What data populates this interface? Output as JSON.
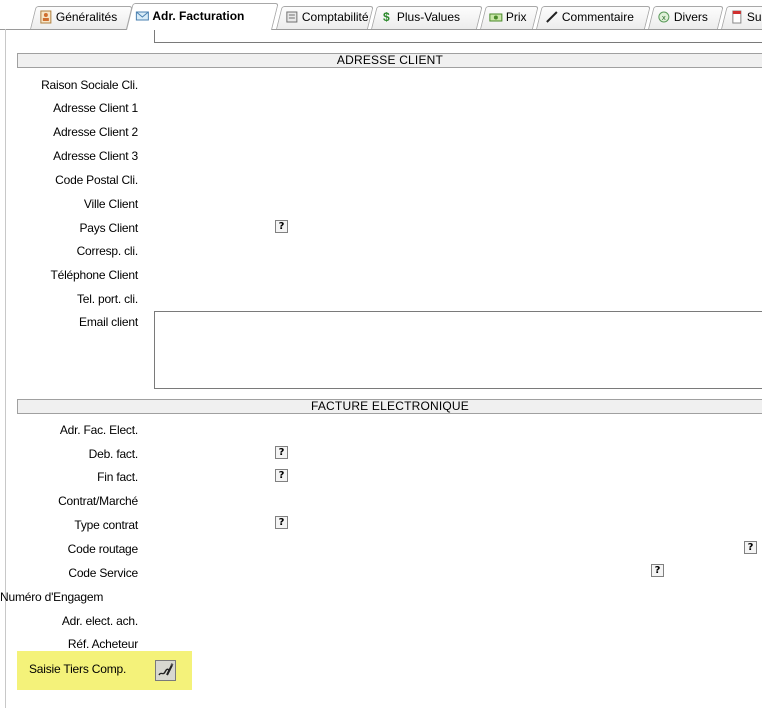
{
  "tabs": [
    {
      "label": "Généralités",
      "icon": "person-card-icon",
      "active": false
    },
    {
      "label": "Adr. Facturation",
      "icon": "envelope-icon",
      "active": true
    },
    {
      "label": "Comptabilité",
      "icon": "ledger-icon",
      "active": false
    },
    {
      "label": "Plus-Values",
      "icon": "dollar-icon",
      "active": false
    },
    {
      "label": "Prix",
      "icon": "money-icon",
      "active": false
    },
    {
      "label": "Commentaire",
      "icon": "pencil-icon",
      "active": false
    },
    {
      "label": "Divers",
      "icon": "spreadsheet-icon",
      "active": false
    },
    {
      "label": "Su",
      "icon": "document-icon",
      "active": false
    }
  ],
  "sections": {
    "adresse_client": "ADRESSE CLIENT",
    "facture_electronique": "FACTURE ELECTRONIQUE"
  },
  "client": {
    "raison_sociale": "Raison Sociale Cli.",
    "adresse1": "Adresse Client 1",
    "adresse2": "Adresse Client 2",
    "adresse3": "Adresse Client 3",
    "code_postal": "Code Postal Cli.",
    "ville": "Ville Client",
    "pays": "Pays Client",
    "corresp": "Corresp. cli.",
    "telephone": "Téléphone Client",
    "tel_port": "Tel. port. cli.",
    "email": "Email client"
  },
  "facture": {
    "adr_fac_elect": "Adr. Fac. Elect.",
    "deb_fact": "Deb. fact.",
    "fin_fact": "Fin fact.",
    "contrat_marche": "Contrat/Marché",
    "type_contrat": "Type contrat",
    "code_routage": "Code routage",
    "code_service": "Code Service",
    "numero_engagement": "Numéro d'Engagem",
    "adr_elect_ach": "Adr. elect. ach.",
    "ref_acheteur": "Réf. Acheteur"
  },
  "help_label": "?",
  "saisie_tiers": {
    "label": "Saisie Tiers Comp.",
    "icon": "signature-pen-icon"
  },
  "colors": {
    "highlight": "#f4f27a",
    "section_bg": "#f0f0f0",
    "border": "#7a7a7a"
  }
}
